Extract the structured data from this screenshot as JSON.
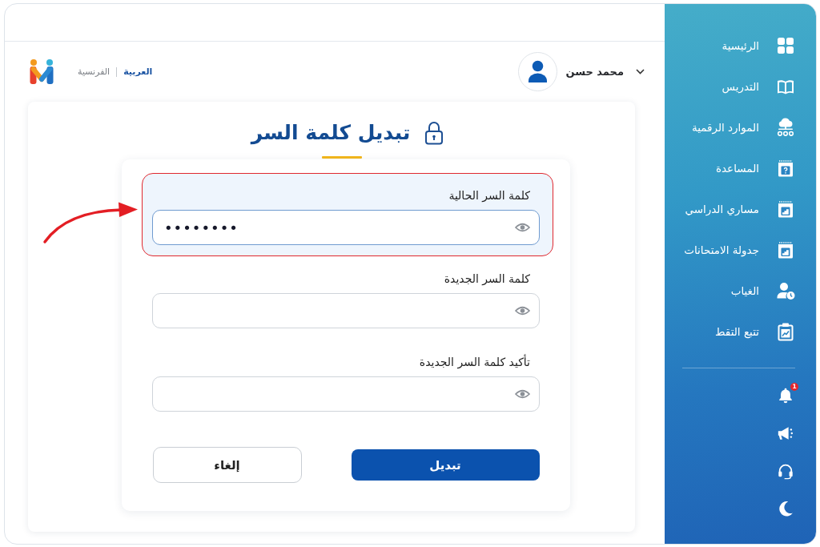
{
  "header": {
    "languages": [
      {
        "label": "العربية",
        "selected": true
      },
      {
        "label": "الفرنسية",
        "selected": false
      }
    ],
    "user": {
      "name": "محمد حسن"
    }
  },
  "page": {
    "title": "تبديل كلمة السر",
    "fields": [
      {
        "label": "كلمة السر الحالية",
        "value": "••••••••",
        "focused": true,
        "highlighted": true
      },
      {
        "label": "كلمة السر الجديدة",
        "focused": false,
        "highlighted": false
      },
      {
        "label": "تأكيد كلمة السر الجديدة",
        "focused": false,
        "highlighted": false
      }
    ],
    "buttons": [
      {
        "label": "تبديل",
        "kind": "primary"
      },
      {
        "label": "إلغاء",
        "kind": "secondary"
      }
    ]
  },
  "sidebar": {
    "items": [
      {
        "label": "الرئيسية",
        "selected": false
      },
      {
        "label": "التدريس",
        "selected": false
      },
      {
        "label": "الموارد الرقمية",
        "selected": false
      },
      {
        "label": "المساعدة",
        "selected": false
      },
      {
        "label": "مساري الدراسي",
        "selected": false
      },
      {
        "label": "جدولة الامتحانات",
        "selected": false
      },
      {
        "label": "الغياب",
        "selected": false
      },
      {
        "label": "تتبع التقط",
        "selected": false
      }
    ],
    "notification_badge": "1"
  }
}
